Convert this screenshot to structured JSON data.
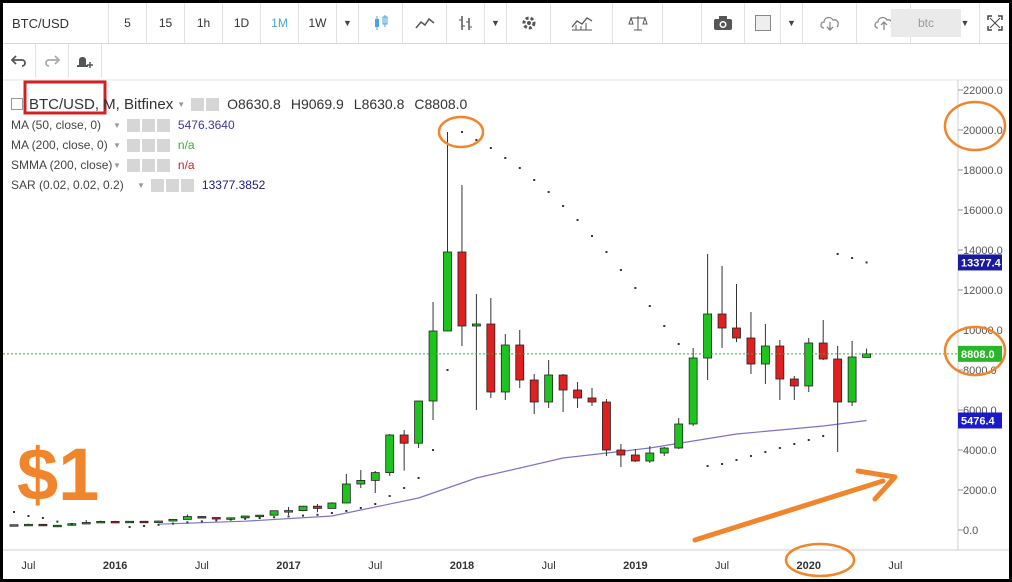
{
  "toolbar": {
    "symbol": "BTC/USD",
    "timeframes": [
      "5",
      "15",
      "1h",
      "1D",
      "1M",
      "1W"
    ],
    "active_timeframe": "1M",
    "search_value": "btc"
  },
  "legend": {
    "symbol": "BTC/USD",
    "interval_exchange": ", M, Bitfinex",
    "ohlc": {
      "open": "O8630.8",
      "high": "H9069.9",
      "low": "L8630.8",
      "close": "C8808.0"
    },
    "indicators": [
      {
        "label": "MA (50, close, 0)",
        "value": "5476.3640",
        "color": "#3a3aa0"
      },
      {
        "label": "MA (200, close, 0)",
        "value": "n/a",
        "color": "#2bb52b"
      },
      {
        "label": "SMMA (200, close)",
        "value": "n/a",
        "color": "#d42020"
      },
      {
        "label": "SAR (0.02, 0.02, 0.2)",
        "value": "13377.3852",
        "color": "#1a1a8c"
      }
    ]
  },
  "annotation": {
    "text": "$1",
    "color": "#f0852b"
  },
  "colors": {
    "up": "#1ec41e",
    "down": "#e02020",
    "ma": "#7b73c8",
    "sar": "#333333",
    "last": "#2bb52b",
    "annotation": "#f0852b"
  },
  "price_labels": {
    "last": {
      "value": 8808.0,
      "text": "8808.0",
      "color": "#2bb52b"
    },
    "sar": {
      "value": 13377.4,
      "text": "13377.4",
      "color": "#1a1a9c"
    },
    "ma": {
      "value": 5476.4,
      "text": "5476.4",
      "color": "#1a1acc"
    }
  },
  "chart_data": {
    "type": "candlestick",
    "y_axis": {
      "min": -1000,
      "max": 22500,
      "ticks": [
        0,
        2000,
        4000,
        6000,
        8000,
        10000,
        12000,
        14000,
        16000,
        18000,
        20000,
        22000
      ],
      "tick_labels": [
        "0.0",
        "2000.0",
        "4000.0",
        "6000.0",
        "8000.0",
        "10000.0",
        "12000.0",
        "14000.0",
        "16000.0",
        "18000.0",
        "20000.0",
        "22000.0"
      ]
    },
    "x_axis": {
      "labels": [
        {
          "text": "Jul",
          "month": "2015-07"
        },
        {
          "text": "2016",
          "month": "2016-01"
        },
        {
          "text": "Jul",
          "month": "2016-07"
        },
        {
          "text": "2017",
          "month": "2017-01"
        },
        {
          "text": "Jul",
          "month": "2017-07"
        },
        {
          "text": "2018",
          "month": "2018-01"
        },
        {
          "text": "Jul",
          "month": "2018-07"
        },
        {
          "text": "2019",
          "month": "2019-01"
        },
        {
          "text": "Jul",
          "month": "2019-07"
        },
        {
          "text": "2020",
          "month": "2020-01"
        },
        {
          "text": "Jul",
          "month": "2020-07"
        }
      ]
    },
    "candles": [
      {
        "month": "2015-06",
        "o": 230,
        "h": 264,
        "l": 220,
        "c": 263
      },
      {
        "month": "2015-07",
        "o": 263,
        "h": 315,
        "l": 255,
        "c": 284
      },
      {
        "month": "2015-08",
        "o": 284,
        "h": 285,
        "l": 198,
        "c": 230
      },
      {
        "month": "2015-09",
        "o": 230,
        "h": 245,
        "l": 225,
        "c": 236
      },
      {
        "month": "2015-10",
        "o": 236,
        "h": 330,
        "l": 234,
        "c": 314
      },
      {
        "month": "2015-11",
        "o": 314,
        "h": 500,
        "l": 300,
        "c": 377
      },
      {
        "month": "2015-12",
        "o": 377,
        "h": 470,
        "l": 350,
        "c": 430
      },
      {
        "month": "2016-01",
        "o": 430,
        "h": 460,
        "l": 350,
        "c": 368
      },
      {
        "month": "2016-02",
        "o": 368,
        "h": 445,
        "l": 365,
        "c": 437
      },
      {
        "month": "2016-03",
        "o": 437,
        "h": 440,
        "l": 400,
        "c": 416
      },
      {
        "month": "2016-04",
        "o": 416,
        "h": 468,
        "l": 413,
        "c": 448
      },
      {
        "month": "2016-05",
        "o": 448,
        "h": 550,
        "l": 440,
        "c": 531
      },
      {
        "month": "2016-06",
        "o": 531,
        "h": 780,
        "l": 530,
        "c": 673
      },
      {
        "month": "2016-07",
        "o": 673,
        "h": 700,
        "l": 605,
        "c": 624
      },
      {
        "month": "2016-08",
        "o": 624,
        "h": 630,
        "l": 540,
        "c": 573
      },
      {
        "month": "2016-09",
        "o": 573,
        "h": 615,
        "l": 570,
        "c": 609
      },
      {
        "month": "2016-10",
        "o": 609,
        "h": 720,
        "l": 605,
        "c": 699
      },
      {
        "month": "2016-11",
        "o": 699,
        "h": 755,
        "l": 685,
        "c": 741
      },
      {
        "month": "2016-12",
        "o": 741,
        "h": 975,
        "l": 740,
        "c": 963
      },
      {
        "month": "2017-01",
        "o": 963,
        "h": 1150,
        "l": 750,
        "c": 970
      },
      {
        "month": "2017-02",
        "o": 970,
        "h": 1210,
        "l": 940,
        "c": 1190
      },
      {
        "month": "2017-03",
        "o": 1190,
        "h": 1300,
        "l": 890,
        "c": 1080
      },
      {
        "month": "2017-04",
        "o": 1080,
        "h": 1390,
        "l": 1080,
        "c": 1350
      },
      {
        "month": "2017-05",
        "o": 1350,
        "h": 2800,
        "l": 1340,
        "c": 2300
      },
      {
        "month": "2017-06",
        "o": 2300,
        "h": 3000,
        "l": 2100,
        "c": 2480
      },
      {
        "month": "2017-07",
        "o": 2480,
        "h": 2950,
        "l": 1850,
        "c": 2870
      },
      {
        "month": "2017-08",
        "o": 2870,
        "h": 4800,
        "l": 2700,
        "c": 4750
      },
      {
        "month": "2017-09",
        "o": 4750,
        "h": 5000,
        "l": 2970,
        "c": 4340
      },
      {
        "month": "2017-10",
        "o": 4340,
        "h": 6450,
        "l": 4100,
        "c": 6450
      },
      {
        "month": "2017-11",
        "o": 6450,
        "h": 11400,
        "l": 5500,
        "c": 9950
      },
      {
        "month": "2017-12",
        "o": 9950,
        "h": 19900,
        "l": 10000,
        "c": 13900
      },
      {
        "month": "2018-01",
        "o": 13900,
        "h": 17250,
        "l": 9200,
        "c": 10200
      },
      {
        "month": "2018-02",
        "o": 10200,
        "h": 11800,
        "l": 6000,
        "c": 10300
      },
      {
        "month": "2018-03",
        "o": 10300,
        "h": 11600,
        "l": 6600,
        "c": 6900
      },
      {
        "month": "2018-04",
        "o": 6900,
        "h": 9800,
        "l": 6500,
        "c": 9250
      },
      {
        "month": "2018-05",
        "o": 9250,
        "h": 10000,
        "l": 7100,
        "c": 7500
      },
      {
        "month": "2018-06",
        "o": 7500,
        "h": 7800,
        "l": 5800,
        "c": 6400
      },
      {
        "month": "2018-07",
        "o": 6400,
        "h": 8500,
        "l": 6100,
        "c": 7750
      },
      {
        "month": "2018-08",
        "o": 7750,
        "h": 7800,
        "l": 5900,
        "c": 7000
      },
      {
        "month": "2018-09",
        "o": 7000,
        "h": 7400,
        "l": 6100,
        "c": 6600
      },
      {
        "month": "2018-10",
        "o": 6600,
        "h": 7100,
        "l": 6200,
        "c": 6400
      },
      {
        "month": "2018-11",
        "o": 6400,
        "h": 6550,
        "l": 3700,
        "c": 4000
      },
      {
        "month": "2018-12",
        "o": 4000,
        "h": 4300,
        "l": 3150,
        "c": 3750
      },
      {
        "month": "2019-01",
        "o": 3750,
        "h": 4050,
        "l": 3400,
        "c": 3450
      },
      {
        "month": "2019-02",
        "o": 3450,
        "h": 4200,
        "l": 3350,
        "c": 3850
      },
      {
        "month": "2019-03",
        "o": 3850,
        "h": 4150,
        "l": 3700,
        "c": 4100
      },
      {
        "month": "2019-04",
        "o": 4100,
        "h": 5600,
        "l": 4050,
        "c": 5300
      },
      {
        "month": "2019-05",
        "o": 5300,
        "h": 9100,
        "l": 5200,
        "c": 8600
      },
      {
        "month": "2019-06",
        "o": 8600,
        "h": 13800,
        "l": 7500,
        "c": 10800
      },
      {
        "month": "2019-07",
        "o": 10800,
        "h": 13200,
        "l": 9100,
        "c": 10100
      },
      {
        "month": "2019-08",
        "o": 10100,
        "h": 12300,
        "l": 9400,
        "c": 9600
      },
      {
        "month": "2019-09",
        "o": 9600,
        "h": 10900,
        "l": 7800,
        "c": 8300
      },
      {
        "month": "2019-10",
        "o": 8300,
        "h": 10300,
        "l": 7300,
        "c": 9200
      },
      {
        "month": "2019-11",
        "o": 9200,
        "h": 9500,
        "l": 6500,
        "c": 7550
      },
      {
        "month": "2019-12",
        "o": 7550,
        "h": 7700,
        "l": 6500,
        "c": 7200
      },
      {
        "month": "2020-01",
        "o": 7200,
        "h": 9600,
        "l": 6900,
        "c": 9350
      },
      {
        "month": "2020-02",
        "o": 9350,
        "h": 10500,
        "l": 8500,
        "c": 8550
      },
      {
        "month": "2020-03",
        "o": 8550,
        "h": 9200,
        "l": 3900,
        "c": 6400
      },
      {
        "month": "2020-04",
        "o": 6400,
        "h": 9450,
        "l": 6200,
        "c": 8650
      },
      {
        "month": "2020-05",
        "o": 8630.8,
        "h": 9069.9,
        "l": 8630.8,
        "c": 8808.0
      }
    ],
    "ma50": [
      {
        "month": "2016-04",
        "v": 290
      },
      {
        "month": "2016-10",
        "v": 440
      },
      {
        "month": "2017-04",
        "v": 700
      },
      {
        "month": "2017-10",
        "v": 1600
      },
      {
        "month": "2018-02",
        "v": 2600
      },
      {
        "month": "2018-08",
        "v": 3600
      },
      {
        "month": "2019-02",
        "v": 4100
      },
      {
        "month": "2019-08",
        "v": 4800
      },
      {
        "month": "2020-02",
        "v": 5200
      },
      {
        "month": "2020-05",
        "v": 5476.4
      }
    ],
    "sar": [
      {
        "month": "2015-06",
        "v": 900
      },
      {
        "month": "2015-07",
        "v": 700
      },
      {
        "month": "2015-08",
        "v": 600
      },
      {
        "month": "2015-09",
        "v": 420
      },
      {
        "month": "2015-10",
        "v": 300
      },
      {
        "month": "2016-02",
        "v": 150
      },
      {
        "month": "2016-03",
        "v": 200
      },
      {
        "month": "2016-04",
        "v": 260
      },
      {
        "month": "2016-05",
        "v": 320
      },
      {
        "month": "2016-06",
        "v": 380
      },
      {
        "month": "2016-07",
        "v": 430
      },
      {
        "month": "2016-08",
        "v": 480
      },
      {
        "month": "2016-09",
        "v": 520
      },
      {
        "month": "2016-10",
        "v": 560
      },
      {
        "month": "2016-11",
        "v": 600
      },
      {
        "month": "2016-12",
        "v": 640
      },
      {
        "month": "2017-01",
        "v": 680
      },
      {
        "month": "2017-02",
        "v": 720
      },
      {
        "month": "2017-03",
        "v": 760
      },
      {
        "month": "2017-04",
        "v": 850
      },
      {
        "month": "2017-05",
        "v": 950
      },
      {
        "month": "2017-06",
        "v": 1100
      },
      {
        "month": "2017-07",
        "v": 1300
      },
      {
        "month": "2017-08",
        "v": 1700
      },
      {
        "month": "2017-09",
        "v": 2100
      },
      {
        "month": "2017-10",
        "v": 2600
      },
      {
        "month": "2017-11",
        "v": 4000
      },
      {
        "month": "2017-12",
        "v": 8000
      },
      {
        "month": "2018-01",
        "v": 19900
      },
      {
        "month": "2018-02",
        "v": 19500
      },
      {
        "month": "2018-03",
        "v": 19100
      },
      {
        "month": "2018-04",
        "v": 18600
      },
      {
        "month": "2018-05",
        "v": 18100
      },
      {
        "month": "2018-06",
        "v": 17500
      },
      {
        "month": "2018-07",
        "v": 16900
      },
      {
        "month": "2018-08",
        "v": 16200
      },
      {
        "month": "2018-09",
        "v": 15500
      },
      {
        "month": "2018-10",
        "v": 14700
      },
      {
        "month": "2018-11",
        "v": 13900
      },
      {
        "month": "2018-12",
        "v": 13000
      },
      {
        "month": "2019-01",
        "v": 12100
      },
      {
        "month": "2019-02",
        "v": 11200
      },
      {
        "month": "2019-03",
        "v": 10200
      },
      {
        "month": "2019-04",
        "v": 9300
      },
      {
        "month": "2019-06",
        "v": 3200
      },
      {
        "month": "2019-07",
        "v": 3300
      },
      {
        "month": "2019-08",
        "v": 3500
      },
      {
        "month": "2019-09",
        "v": 3700
      },
      {
        "month": "2019-10",
        "v": 3900
      },
      {
        "month": "2019-11",
        "v": 4100
      },
      {
        "month": "2019-12",
        "v": 4300
      },
      {
        "month": "2020-01",
        "v": 4500
      },
      {
        "month": "2020-02",
        "v": 4700
      },
      {
        "month": "2020-03",
        "v": 13800
      },
      {
        "month": "2020-04",
        "v": 13600
      },
      {
        "month": "2020-05",
        "v": 13377.4
      }
    ],
    "last_price": 8808.0,
    "grid": false
  }
}
